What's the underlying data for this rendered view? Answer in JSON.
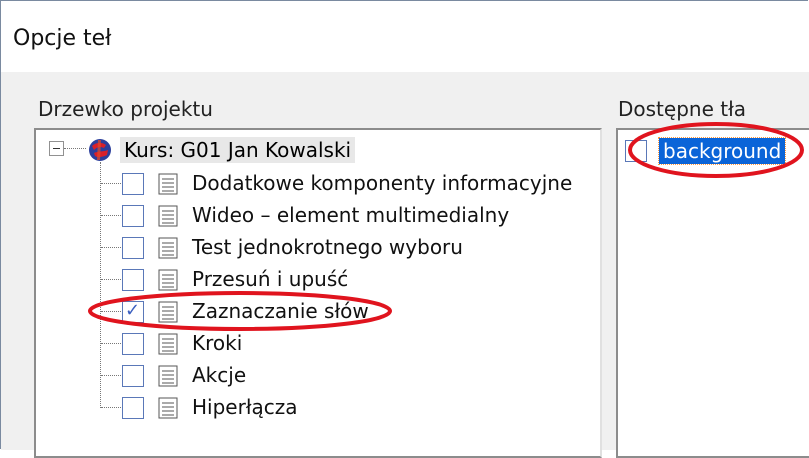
{
  "window": {
    "title": "Opcje teł"
  },
  "project_tree": {
    "label": "Drzewko projektu",
    "root": {
      "label": "Kurs: G01 Jan Kowalski",
      "icon": "course-globe-icon",
      "expanded": true
    },
    "items": [
      {
        "label": "Dodatkowe komponenty informacyjne",
        "checked": false,
        "icon": "page-icon"
      },
      {
        "label": "Wideo – element multimedialny",
        "checked": false,
        "icon": "page-icon"
      },
      {
        "label": "Test jednokrotnego wyboru",
        "checked": false,
        "icon": "page-icon"
      },
      {
        "label": "Przesuń i upuść",
        "checked": false,
        "icon": "page-icon"
      },
      {
        "label": "Zaznaczanie słów",
        "checked": true,
        "icon": "page-icon",
        "annotated": true
      },
      {
        "label": "Kroki",
        "checked": false,
        "icon": "page-icon"
      },
      {
        "label": "Akcje",
        "checked": false,
        "icon": "page-icon"
      },
      {
        "label": "Hiperłącza",
        "checked": false,
        "icon": "page-icon"
      }
    ]
  },
  "backgrounds": {
    "label": "Dostępne tła",
    "items": [
      {
        "label": "background",
        "checked": false,
        "selected": true,
        "annotated": true
      }
    ]
  },
  "colors": {
    "annotation": "#e0141e",
    "selection": "#0a64d8",
    "checkbox_border": "#5a78b8",
    "panel_bg": "#f0f0f0"
  }
}
